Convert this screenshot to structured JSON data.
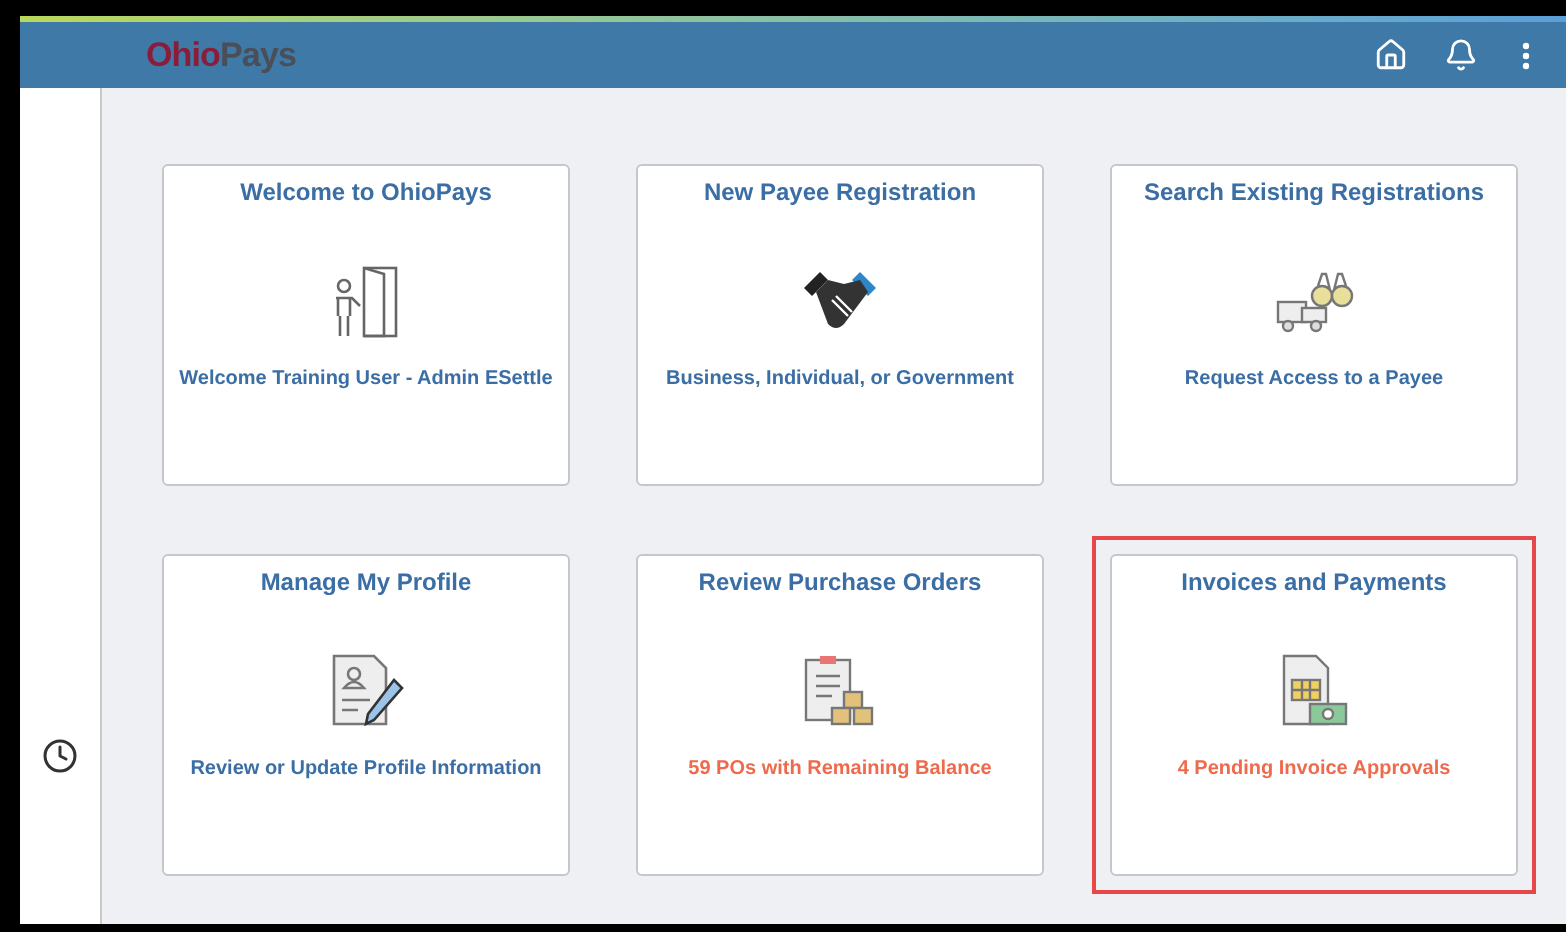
{
  "header": {
    "logo_first": "Ohio",
    "logo_second": "Pays"
  },
  "tiles": [
    {
      "title": "Welcome to OhioPays",
      "detail": "Welcome Training User - Admin ESettle",
      "kind": "info",
      "highlighted": false
    },
    {
      "title": "New Payee Registration",
      "detail": "Business, Individual, or Government",
      "kind": "info",
      "highlighted": false
    },
    {
      "title": "Search Existing Registrations",
      "detail": "Request Access to a Payee",
      "kind": "info",
      "highlighted": false
    },
    {
      "title": "Manage My Profile",
      "detail": "Review or Update Profile Information",
      "kind": "info",
      "highlighted": false
    },
    {
      "title": "Review Purchase Orders",
      "detail": "59 POs with Remaining Balance",
      "kind": "alert",
      "highlighted": false
    },
    {
      "title": "Invoices and Payments",
      "detail": "4 Pending Invoice Approvals",
      "kind": "alert",
      "highlighted": true
    }
  ]
}
